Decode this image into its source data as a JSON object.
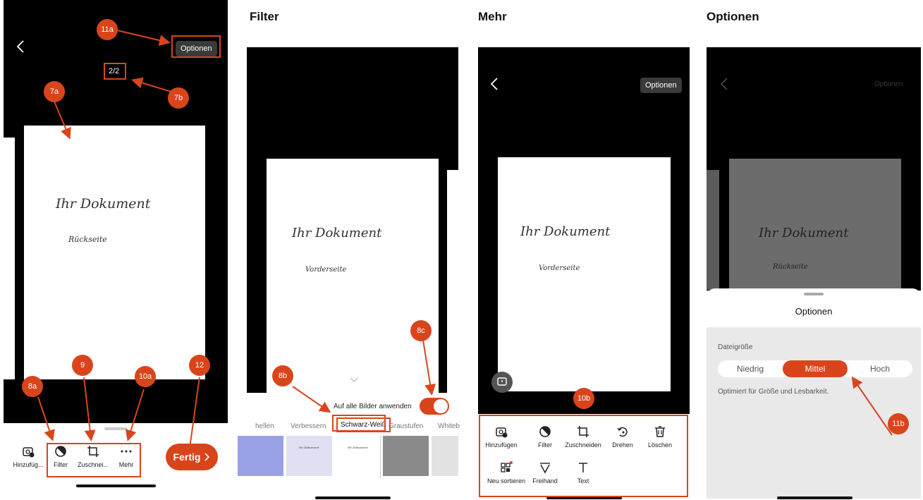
{
  "panel_titles": {
    "filter": "Filter",
    "mehr": "Mehr",
    "optionen": "Optionen"
  },
  "screen1": {
    "options_button": "Optionen",
    "page_counter": "2/2",
    "doc_title": "Ihr Dokument",
    "doc_subtitle": "Rückseite",
    "toolbar": {
      "add": "Hinzufüg...",
      "filter": "Filter",
      "crop": "Zuschnei...",
      "more": "Mehr"
    },
    "done_button": "Fertig"
  },
  "screen2": {
    "doc_title": "Ihr Dokument",
    "doc_subtitle": "Vorderseite",
    "apply_all_label": "Auf alle Bilder anwenden",
    "filters": [
      "hellen",
      "Verbessern",
      "Schwarz-Weiß",
      "Graustufen",
      "Whiteb"
    ],
    "thumb_text": "Ihr Dokument"
  },
  "screen3": {
    "options_button": "Optionen",
    "doc_title": "Ihr Dokument",
    "doc_subtitle": "Vorderseite",
    "tools": {
      "add": "Hinzufügen",
      "filter": "Filter",
      "crop": "Zuschneiden",
      "rotate": "Drehen",
      "delete": "Löschen",
      "reorder": "Neu sortieren",
      "freehand": "Freihand",
      "text": "Text"
    }
  },
  "screen4": {
    "options_button": "Optionen",
    "doc_title": "Ihr Dokument",
    "doc_subtitle": "Rückseite",
    "sheet_title": "Optionen",
    "filesize_label": "Dateigröße",
    "segments": [
      "Niedrig",
      "Mittel",
      "Hoch"
    ],
    "selected_segment": "Mittel",
    "description": "Optimiert für Größe und Lesbarkeit."
  },
  "badges": {
    "b11a": "11a",
    "b7a": "7a",
    "b7b": "7b",
    "b8a": "8a",
    "b9": "9",
    "b10a": "10a",
    "b12": "12",
    "b8b": "8b",
    "b8c": "8c",
    "b10b": "10b",
    "b11b": "11b"
  },
  "colors": {
    "accent": "#d9451b",
    "sheet_gray": "#e9e9e9"
  }
}
